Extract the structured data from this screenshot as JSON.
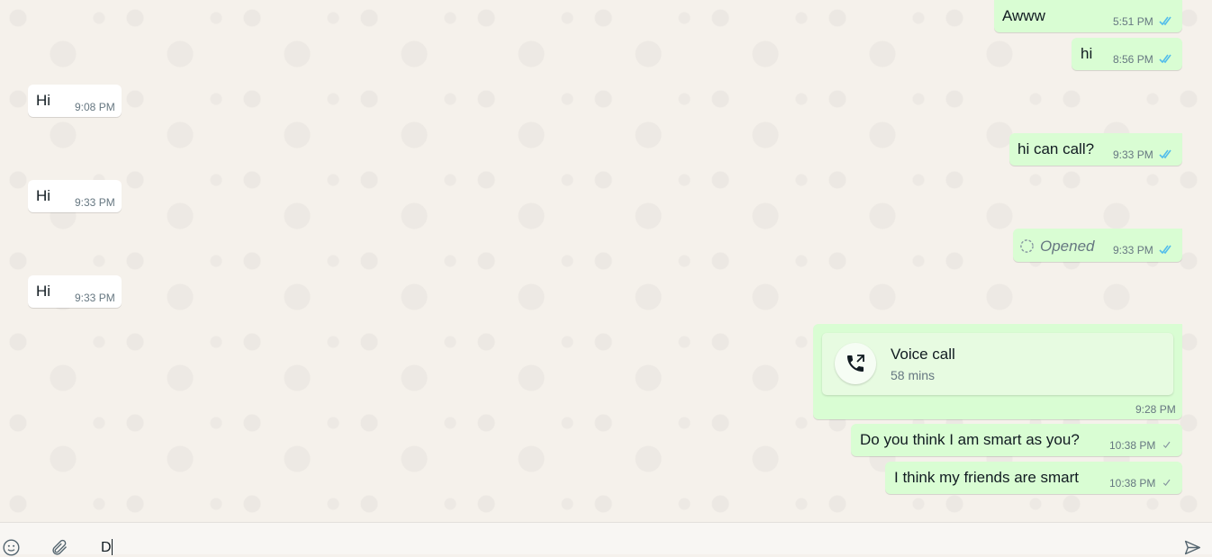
{
  "messages": [
    {
      "dir": "out",
      "text": "Awww",
      "time": "5:51 PM",
      "status": "read"
    },
    {
      "dir": "out",
      "text": "hi",
      "time": "8:56 PM",
      "status": "read"
    },
    {
      "dir": "in",
      "text": "Hi",
      "time": "9:08 PM"
    },
    {
      "dir": "out",
      "text": "hi can call?",
      "time": "9:33 PM",
      "status": "read"
    },
    {
      "dir": "in",
      "text": "Hi",
      "time": "9:33 PM"
    },
    {
      "dir": "out",
      "text": "Opened",
      "time": "9:33 PM",
      "status": "read"
    },
    {
      "dir": "in",
      "text": "Hi",
      "time": "9:33 PM"
    },
    {
      "dir": "out",
      "call_title": "Voice call",
      "call_duration": "58 mins",
      "time": "9:28 PM"
    },
    {
      "dir": "out",
      "text": "Do you think I am smart as you?",
      "time": "10:38 PM",
      "status": "sent"
    },
    {
      "dir": "out",
      "text": "I think my friends are smart",
      "time": "10:38 PM",
      "status": "sent"
    }
  ],
  "composer": {
    "value": "D"
  },
  "icons": {
    "emoji": "emoji-icon",
    "attach": "paperclip-icon",
    "send": "send-icon",
    "call": "phone-outgoing-icon",
    "read": "double-check-icon",
    "sent": "single-check-icon",
    "viewonce": "view-once-icon"
  },
  "colors": {
    "outgoing_bubble": "#d9fdd3",
    "incoming_bubble": "#ffffff",
    "read_tick": "#53bdeb",
    "background": "#f5f1eb"
  }
}
